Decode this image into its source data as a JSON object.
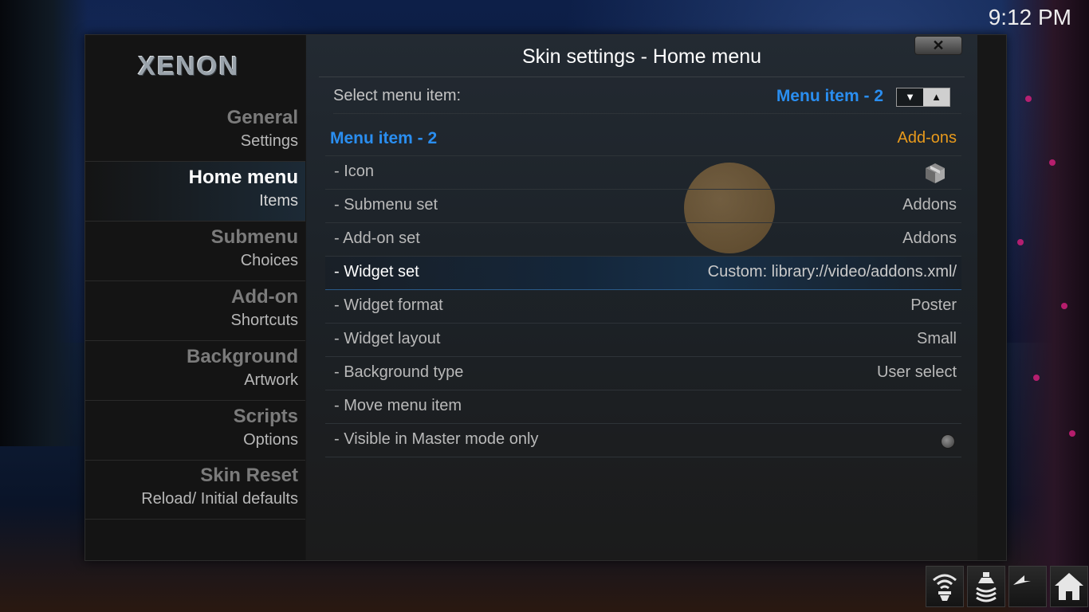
{
  "clock": "9:12 PM",
  "logo": "XENON",
  "dialog": {
    "title": "Skin settings - Home menu",
    "close_label": "✕"
  },
  "sidebar": {
    "items": [
      {
        "title": "General",
        "sub": "Settings",
        "active": false
      },
      {
        "title": "Home menu",
        "sub": "Items",
        "active": true
      },
      {
        "title": "Submenu",
        "sub": "Choices",
        "active": false
      },
      {
        "title": "Add-on",
        "sub": "Shortcuts",
        "active": false
      },
      {
        "title": "Background",
        "sub": "Artwork",
        "active": false
      },
      {
        "title": "Scripts",
        "sub": "Options",
        "active": false
      },
      {
        "title": "Skin Reset",
        "sub": "Reload/ Initial defaults",
        "active": false
      }
    ]
  },
  "selector": {
    "label": "Select menu item:",
    "value": "Menu item - 2",
    "down_symbol": "▼",
    "up_symbol": "▲"
  },
  "rows": [
    {
      "label": "Menu item - 2",
      "value": "Add-ons"
    },
    {
      "label": "- Icon",
      "value": "",
      "icon": "addon-box-icon"
    },
    {
      "label": "- Submenu set",
      "value": "Addons"
    },
    {
      "label": "- Add-on set",
      "value": "Addons"
    },
    {
      "label": "- Widget set",
      "value": "Custom: library://video/addons.xml/",
      "focused": true
    },
    {
      "label": "- Widget format",
      "value": "Poster"
    },
    {
      "label": "- Widget layout",
      "value": "Small"
    },
    {
      "label": "- Background type",
      "value": "User select"
    },
    {
      "label": "- Move menu item",
      "value": ""
    },
    {
      "label": "- Visible in Master mode only",
      "value": "",
      "toggle": "off"
    }
  ],
  "bottom_buttons": [
    "wifi-icon",
    "eject-icon",
    "back-icon",
    "home-icon"
  ],
  "colors": {
    "accent_blue": "#2a8ef0",
    "accent_orange": "#e89a1c"
  }
}
